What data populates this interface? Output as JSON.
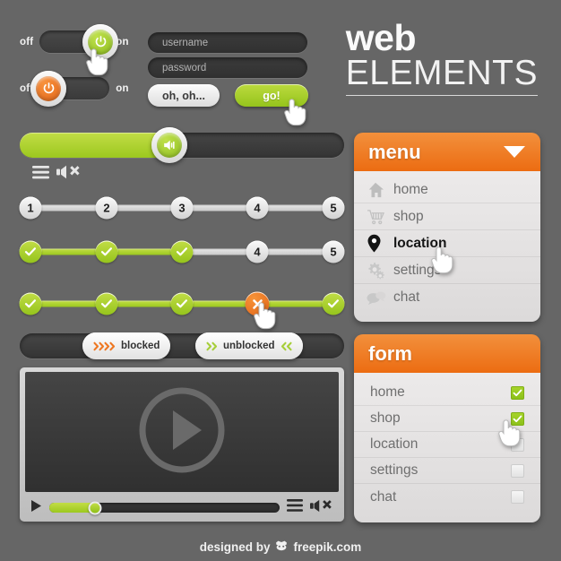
{
  "title": {
    "line1": "web",
    "line2": "ELEMENTS"
  },
  "toggles": [
    {
      "off_label": "off",
      "on_label": "on",
      "state": "on",
      "color": "#a6ce39",
      "icon": "power-icon"
    },
    {
      "off_label": "off",
      "on_label": "on",
      "state": "off",
      "color": "#ee7722",
      "icon": "power-icon"
    }
  ],
  "login": {
    "username_placeholder": "username",
    "password_placeholder": "password",
    "cancel_label": "oh, oh...",
    "submit_label": "go!"
  },
  "volume": {
    "value": 46,
    "icon": "speaker-icon",
    "controls": [
      "menu-icon",
      "speaker-mute-icon"
    ]
  },
  "steppers": [
    {
      "name": "stepper-none-complete",
      "nodes": [
        {
          "label": "1",
          "state": "pending"
        },
        {
          "label": "2",
          "state": "pending"
        },
        {
          "label": "3",
          "state": "pending"
        },
        {
          "label": "4",
          "state": "pending"
        },
        {
          "label": "5",
          "state": "pending"
        }
      ],
      "progress": 0
    },
    {
      "name": "stepper-three-complete",
      "nodes": [
        {
          "label": "",
          "state": "done"
        },
        {
          "label": "",
          "state": "done"
        },
        {
          "label": "",
          "state": "done"
        },
        {
          "label": "4",
          "state": "pending"
        },
        {
          "label": "5",
          "state": "pending"
        }
      ],
      "progress": 50
    },
    {
      "name": "stepper-error",
      "nodes": [
        {
          "label": "",
          "state": "done"
        },
        {
          "label": "",
          "state": "done"
        },
        {
          "label": "",
          "state": "done"
        },
        {
          "label": "",
          "state": "error"
        },
        {
          "label": "",
          "state": "done"
        }
      ],
      "progress": 100
    }
  ],
  "status_toggles": [
    {
      "label": "blocked",
      "color": "#ee7722",
      "arrows": 4,
      "direction": "right",
      "knob_position": "right"
    },
    {
      "label": "unblocked",
      "color": "#a6ce39",
      "arrows": 2,
      "direction": "both",
      "knob_position": "left"
    }
  ],
  "player": {
    "play_icon": "play-circle-icon",
    "play_button": "play-icon",
    "progress": 20,
    "controls": [
      "menu-icon",
      "speaker-mute-icon"
    ]
  },
  "menu": {
    "title": "menu",
    "caret": "chevron-down-icon",
    "items": [
      {
        "label": "home",
        "icon": "home-icon",
        "active": false
      },
      {
        "label": "shop",
        "icon": "cart-icon",
        "active": false
      },
      {
        "label": "location",
        "icon": "pin-icon",
        "active": true
      },
      {
        "label": "settings",
        "icon": "gears-icon",
        "active": false
      },
      {
        "label": "chat",
        "icon": "chat-icon",
        "active": false
      }
    ]
  },
  "form": {
    "title": "form",
    "items": [
      {
        "label": "home",
        "checked": true
      },
      {
        "label": "shop",
        "checked": true
      },
      {
        "label": "location",
        "checked": false
      },
      {
        "label": "settings",
        "checked": false
      },
      {
        "label": "chat",
        "checked": false
      }
    ]
  },
  "footer": {
    "text_before": "designed by",
    "brand": "freepik.com",
    "icon": "freepik-logo-icon"
  },
  "colors": {
    "background": "#666666",
    "green": "#a6ce39",
    "orange": "#ee7722",
    "dark": "#3a3a3a",
    "light": "#ececec"
  }
}
